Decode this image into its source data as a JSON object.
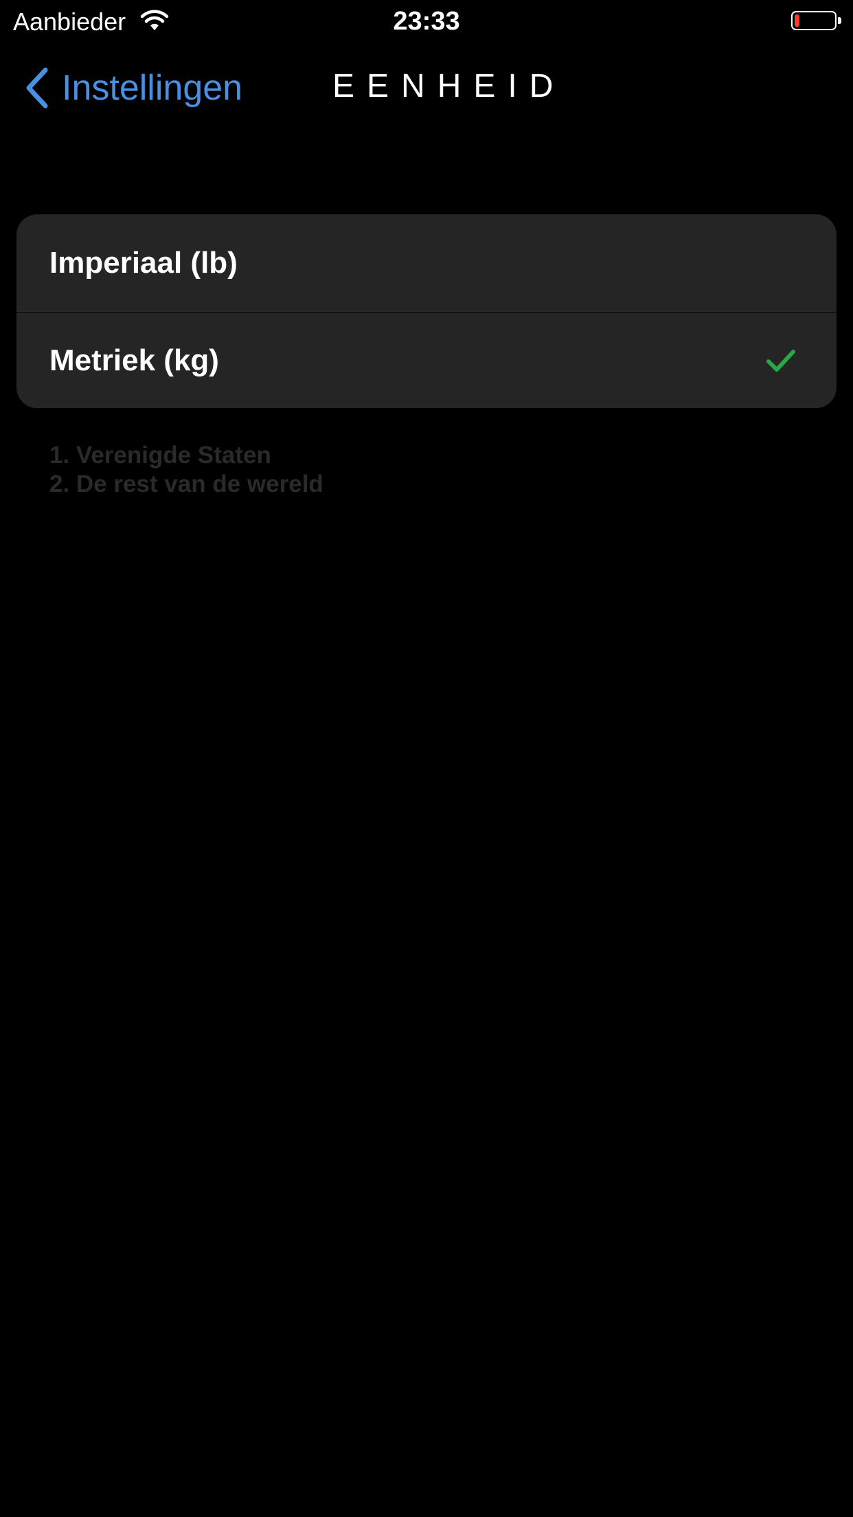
{
  "status_bar": {
    "carrier": "Aanbieder",
    "time": "23:33",
    "battery_level": 0.12,
    "icons": {
      "wifi": "wifi-icon",
      "battery": "battery-icon"
    }
  },
  "nav": {
    "back_label": "Instellingen",
    "back_icon": "chevron-left-icon",
    "title": "EENHEID"
  },
  "options": [
    {
      "label": "Imperiaal (lb)",
      "selected": false
    },
    {
      "label": "Metriek (kg)",
      "selected": true,
      "selected_icon": "checkmark-icon"
    }
  ],
  "footer": {
    "lines": [
      "1. Verenigde Staten",
      "2. De rest van de wereld"
    ]
  },
  "colors": {
    "background": "#000000",
    "accent": "#4a90e2",
    "check": "#27a745",
    "cell_background": "#252525",
    "footer_text": "#2a2a2a",
    "battery_low": "#ff3b30"
  }
}
